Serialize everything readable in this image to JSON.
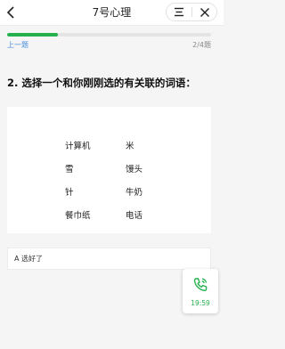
{
  "header": {
    "title": "7号心理",
    "back_icon": "chevron-left-icon",
    "menu_icon": "menu-icon",
    "close_icon": "close-icon"
  },
  "progress": {
    "current": 2,
    "total": 4,
    "fraction": 0.25,
    "counter": "2/4题",
    "prev_label": "上一题",
    "fill_color": "#22b14c"
  },
  "question": {
    "text": "2. 选择一个和你刚刚选的有关联的词语："
  },
  "words": {
    "left": [
      "计算机",
      "雪",
      "针",
      "餐巾纸"
    ],
    "right": [
      "米",
      "馒头",
      "牛奶",
      "电话"
    ]
  },
  "answer": {
    "label": "A  选好了"
  },
  "timer": {
    "icon": "phone-call-icon",
    "time": "19:59"
  }
}
